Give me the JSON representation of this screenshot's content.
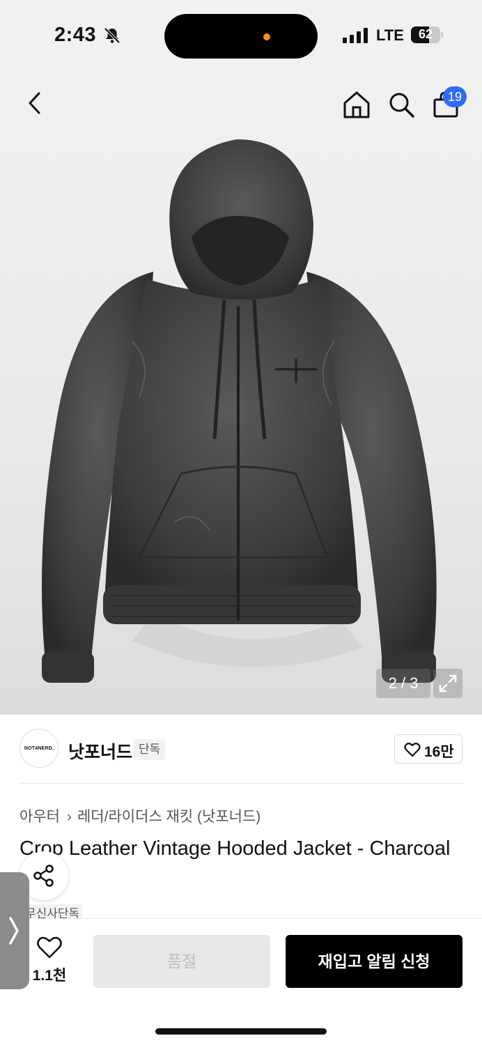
{
  "status_bar": {
    "time": "2:43",
    "network": "LTE",
    "battery_percent": "62",
    "battery_level": 0.62
  },
  "header": {
    "back_icon": "chevron-left-icon",
    "home_icon": "home-icon",
    "search_icon": "search-icon",
    "cart_icon": "shopping-bag-icon",
    "cart_count": "19"
  },
  "gallery": {
    "counter": "2 / 3",
    "expand_icon": "expand-icon"
  },
  "brand": {
    "logo_text": "NOT4NERD.",
    "name": "낫포너드",
    "tag": "단독",
    "like_count": "16만"
  },
  "product": {
    "category": "아우터",
    "subcategory": "레더/라이더스 재킷 (낫포너드)",
    "title": "Crop Leather Vintage Hooded Jacket - Charcoal",
    "exclusive_tag": "무신사단독"
  },
  "bottom_bar": {
    "wish_count": "1.1천",
    "soldout_label": "품절",
    "restock_label": "재입고 알림 신청"
  },
  "colors": {
    "accent_badge": "#2d6cf5",
    "primary_button": "#000000",
    "disabled_button": "#e8e8e8"
  }
}
